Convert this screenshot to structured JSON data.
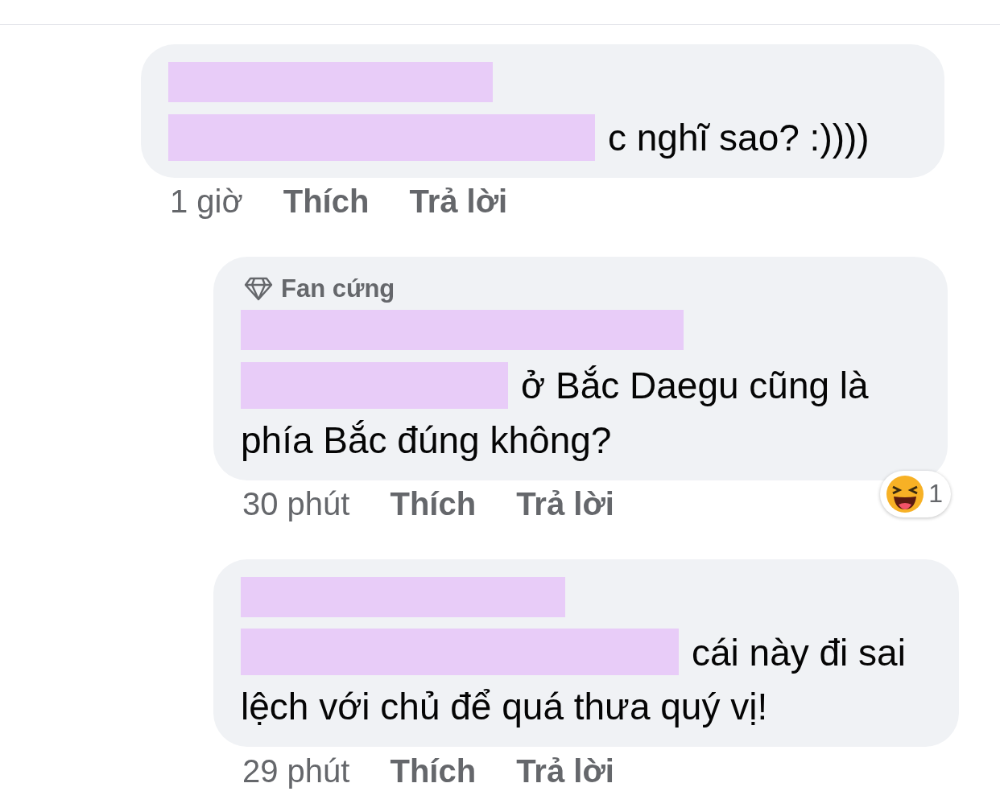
{
  "comments": [
    {
      "indent": false,
      "name": {
        "kind": "redacted"
      },
      "body": [
        {
          "kind": "redacted"
        },
        {
          "kind": "text",
          "text": "c nghĩ sao? :))))"
        }
      ],
      "time": "1 giờ",
      "like": "Thích",
      "reply": "Trả lời"
    },
    {
      "indent": true,
      "badge": {
        "text": "Fan cứng"
      },
      "name": {
        "kind": "redacted"
      },
      "body": [
        {
          "kind": "redacted"
        },
        {
          "kind": "text",
          "text": "ở Bắc Daegu cũng là phía Bắc đúng không?"
        }
      ],
      "time": "30 phút",
      "like": "Thích",
      "reply": "Trả lời",
      "reaction": {
        "kind": "haha",
        "count": "1"
      }
    },
    {
      "indent": true,
      "name": {
        "kind": "redacted"
      },
      "body": [
        {
          "kind": "redacted"
        },
        {
          "kind": "text",
          "text": "cái này đi sai lệch với chủ để quá thưa quý vị!"
        }
      ],
      "time": "29 phút",
      "like": "Thích",
      "reply": "Trả lời"
    }
  ]
}
